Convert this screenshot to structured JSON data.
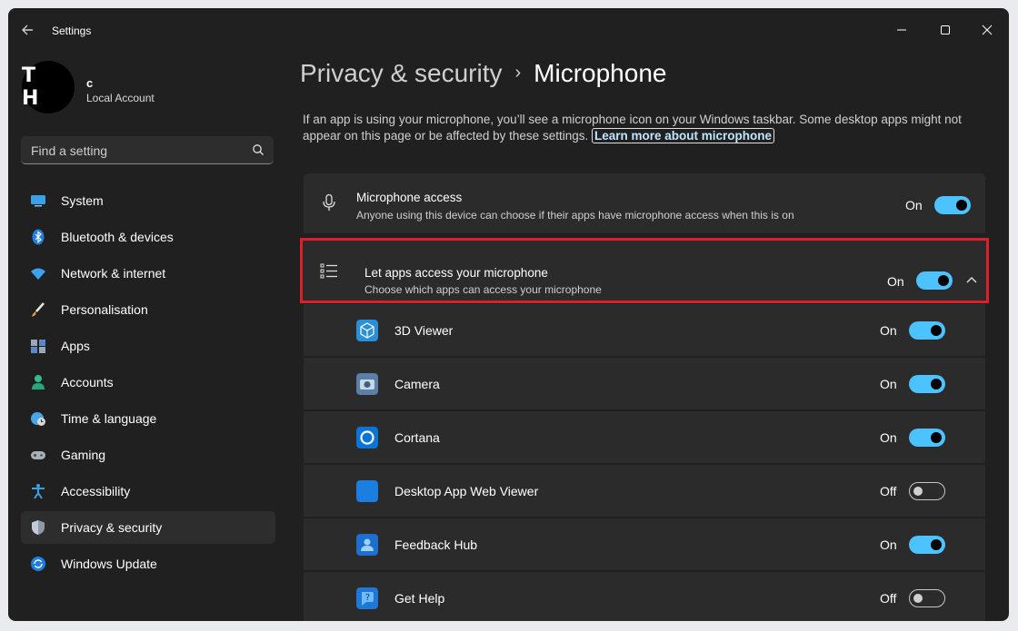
{
  "window": {
    "title": "Settings"
  },
  "user": {
    "initials": "T H",
    "name": "c",
    "account_type": "Local Account"
  },
  "search": {
    "placeholder": "Find a setting"
  },
  "sidebar": {
    "items": [
      {
        "label": "System",
        "icon": "system-icon",
        "active": false
      },
      {
        "label": "Bluetooth & devices",
        "icon": "bluetooth-icon",
        "active": false
      },
      {
        "label": "Network & internet",
        "icon": "wifi-icon",
        "active": false
      },
      {
        "label": "Personalisation",
        "icon": "brush-icon",
        "active": false
      },
      {
        "label": "Apps",
        "icon": "apps-icon",
        "active": false
      },
      {
        "label": "Accounts",
        "icon": "person-icon",
        "active": false
      },
      {
        "label": "Time & language",
        "icon": "globe-clock-icon",
        "active": false
      },
      {
        "label": "Gaming",
        "icon": "gamepad-icon",
        "active": false
      },
      {
        "label": "Accessibility",
        "icon": "accessibility-icon",
        "active": false
      },
      {
        "label": "Privacy & security",
        "icon": "shield-icon",
        "active": true
      },
      {
        "label": "Windows Update",
        "icon": "update-icon",
        "active": false
      }
    ]
  },
  "breadcrumb": {
    "parent": "Privacy & security",
    "separator": "›",
    "current": "Microphone"
  },
  "description": {
    "text": "If an app is using your microphone, you’ll see a microphone icon on your Windows taskbar. Some desktop apps might not appear on this page or be affected by these settings.",
    "link": "Learn more about microphone"
  },
  "microphone_access": {
    "title": "Microphone access",
    "subtitle": "Anyone using this device can choose if their apps have microphone access when this is on",
    "state": "On"
  },
  "let_apps_access": {
    "title": "Let apps access your microphone",
    "subtitle": "Choose which apps can access your microphone",
    "state": "On"
  },
  "apps": [
    {
      "name": "3D Viewer",
      "state": "On",
      "color": "#2b8fd6"
    },
    {
      "name": "Camera",
      "state": "On",
      "color": "#5a7fa8"
    },
    {
      "name": "Cortana",
      "state": "On",
      "color": "#0b74d9"
    },
    {
      "name": "Desktop App Web Viewer",
      "state": "Off",
      "color": "#1a7fe0"
    },
    {
      "name": "Feedback Hub",
      "state": "On",
      "color": "#1c6fd0"
    },
    {
      "name": "Get Help",
      "state": "Off",
      "color": "#1f78d8"
    }
  ],
  "colors": {
    "accent": "#4cc2ff",
    "highlight_border": "#d9202b",
    "background": "#202020",
    "card": "#2b2b2b"
  }
}
